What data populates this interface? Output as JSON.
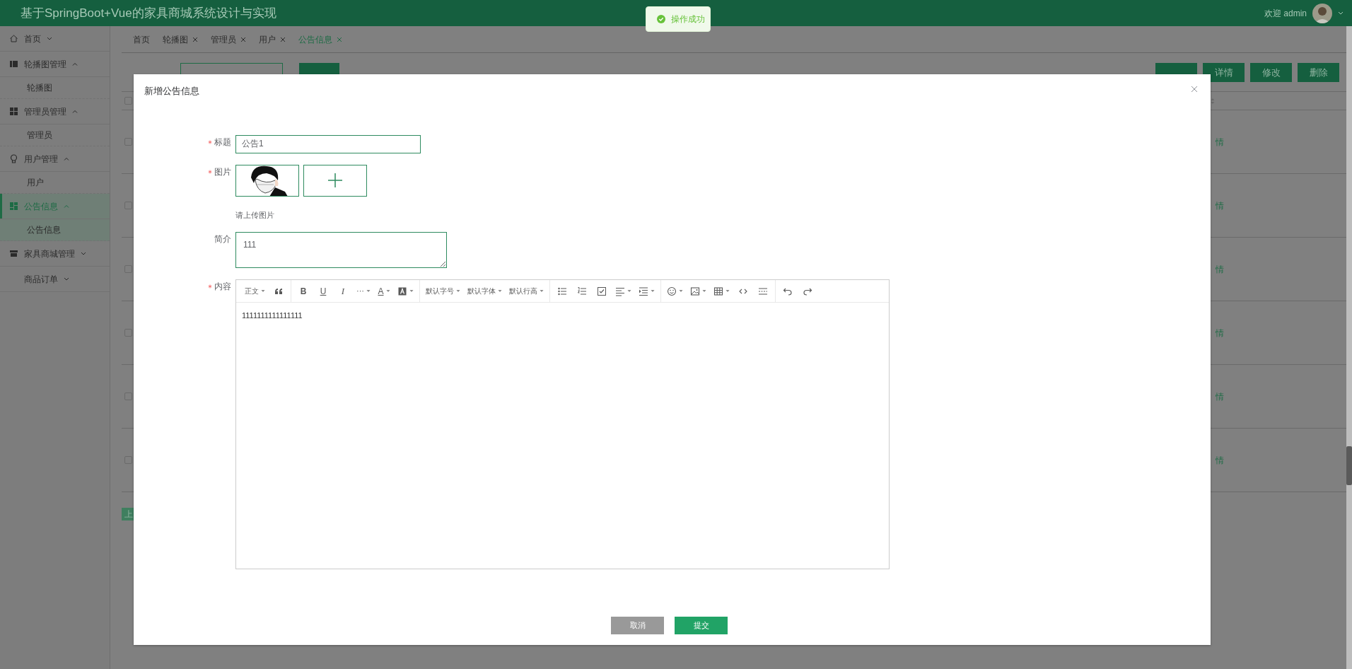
{
  "header": {
    "title": "基于SpringBoot+Vue的家具商城系统设计与实现",
    "welcome": "欢迎 admin"
  },
  "toast": {
    "text": "操作成功"
  },
  "sidebar": {
    "items": [
      {
        "label": "首页",
        "expanded": false,
        "selected": false
      },
      {
        "label": "轮播图管理",
        "expanded": true,
        "selected": false,
        "children": [
          {
            "label": "轮播图",
            "selected": false
          }
        ]
      },
      {
        "label": "管理员管理",
        "expanded": true,
        "selected": false,
        "children": [
          {
            "label": "管理员",
            "selected": false
          }
        ]
      },
      {
        "label": "用户管理",
        "expanded": true,
        "selected": false,
        "children": [
          {
            "label": "用户",
            "selected": false
          }
        ]
      },
      {
        "label": "公告信息",
        "expanded": true,
        "selected": true,
        "children": [
          {
            "label": "公告信息",
            "selected": true
          }
        ]
      },
      {
        "label": "家具商城管理",
        "expanded": false,
        "selected": false
      },
      {
        "label": "商品订单",
        "expanded": false,
        "selected": false
      }
    ]
  },
  "tabs": [
    {
      "label": "首页",
      "closable": false,
      "selected": false
    },
    {
      "label": "轮播图",
      "closable": true,
      "selected": false
    },
    {
      "label": "管理员",
      "closable": true,
      "selected": false
    },
    {
      "label": "用户",
      "closable": true,
      "selected": false
    },
    {
      "label": "公告信息",
      "closable": true,
      "selected": true
    }
  ],
  "actions": [
    "详情",
    "修改",
    "删除"
  ],
  "table": {
    "header_checked": false,
    "rows": [
      {
        "checked": false,
        "link": "情"
      },
      {
        "checked": false,
        "link": "情"
      },
      {
        "checked": false,
        "link": "情"
      },
      {
        "checked": false,
        "link": "情"
      },
      {
        "checked": false,
        "link": "情"
      },
      {
        "checked": false,
        "link": "情"
      }
    ]
  },
  "pagination": {
    "prev": "上"
  },
  "dialog": {
    "title": "新增公告信息",
    "fields": [
      {
        "kind": "input",
        "label": "标题",
        "required": true,
        "value": "公告1"
      },
      {
        "kind": "upload",
        "label": "图片",
        "required": true,
        "hint": "请上传图片"
      },
      {
        "kind": "textarea",
        "label": "简介",
        "required": false,
        "value": "111"
      },
      {
        "kind": "editor",
        "label": "内容",
        "required": true,
        "content": "1111111111111111",
        "toolbar": [
          [
            {
              "kind": "text",
              "label": "正文",
              "dropdown": true
            },
            {
              "kind": "icon",
              "dropdown": false
            }
          ],
          [
            {
              "kind": "bold",
              "label": "B",
              "dropdown": false
            },
            {
              "kind": "underline",
              "label": "U",
              "dropdown": false
            },
            {
              "kind": "italic",
              "label": "I",
              "dropdown": false
            },
            {
              "kind": "glyph",
              "label": "···",
              "dropdown": true
            },
            {
              "kind": "underline",
              "label": "A",
              "dropdown": true
            },
            {
              "kind": "icon",
              "dropdown": true
            }
          ],
          [
            {
              "kind": "text",
              "label": "默认字号",
              "dropdown": true
            },
            {
              "kind": "text",
              "label": "默认字体",
              "dropdown": true
            },
            {
              "kind": "text",
              "label": "默认行高",
              "dropdown": true
            }
          ],
          [
            {
              "kind": "icon",
              "dropdown": false
            },
            {
              "kind": "icon",
              "dropdown": false
            },
            {
              "kind": "icon",
              "dropdown": false
            },
            {
              "kind": "icon",
              "dropdown": true
            },
            {
              "kind": "icon",
              "dropdown": true
            }
          ],
          [
            {
              "kind": "icon",
              "dropdown": true
            },
            {
              "kind": "icon",
              "dropdown": true
            },
            {
              "kind": "icon",
              "dropdown": true
            },
            {
              "kind": "icon",
              "dropdown": false
            },
            {
              "kind": "icon",
              "dropdown": false
            }
          ],
          [
            {
              "kind": "icon",
              "dropdown": false
            },
            {
              "kind": "icon",
              "dropdown": false
            }
          ]
        ]
      }
    ],
    "buttons": [
      {
        "label": "取消",
        "kind": "cancel"
      },
      {
        "label": "提交",
        "kind": "primary"
      }
    ]
  }
}
